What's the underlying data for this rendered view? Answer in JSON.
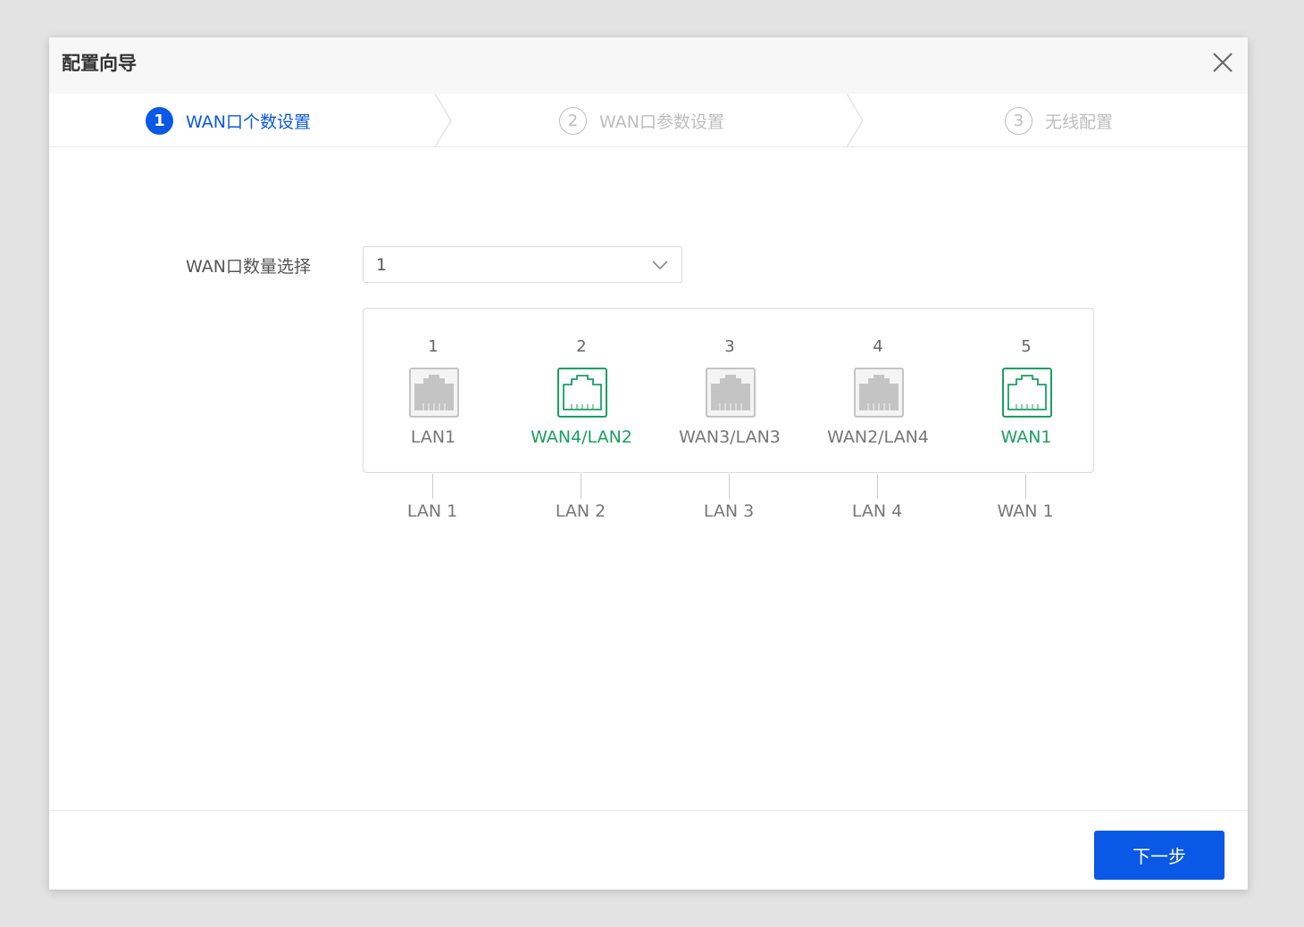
{
  "dialog": {
    "title": "配置向导"
  },
  "steps": [
    {
      "number": "1",
      "label": "WAN口个数设置",
      "state": "active"
    },
    {
      "number": "2",
      "label": "WAN口参数设置",
      "state": "inactive"
    },
    {
      "number": "3",
      "label": "无线配置",
      "state": "inactive"
    }
  ],
  "form": {
    "wan_count_label": "WAN口数量选择",
    "wan_count_value": "1"
  },
  "ports": [
    {
      "number": "1",
      "label": "LAN1",
      "type": "lan",
      "bottom_label": "LAN 1"
    },
    {
      "number": "2",
      "label": "WAN4/LAN2",
      "type": "wan",
      "bottom_label": "LAN 2"
    },
    {
      "number": "3",
      "label": "WAN3/LAN3",
      "type": "lan",
      "bottom_label": "LAN 3"
    },
    {
      "number": "4",
      "label": "WAN2/LAN4",
      "type": "lan",
      "bottom_label": "LAN 4"
    },
    {
      "number": "5",
      "label": "WAN1",
      "type": "wan",
      "bottom_label": "WAN 1"
    }
  ],
  "footer": {
    "next_label": "下一步"
  },
  "colors": {
    "primary": "#0a58e6",
    "wan_port": "#1aa062",
    "lan_port": "#c4c4c4"
  },
  "icons": {
    "close": "close-icon",
    "dropdown": "chevron-down-icon",
    "port": "ethernet-port-icon"
  }
}
